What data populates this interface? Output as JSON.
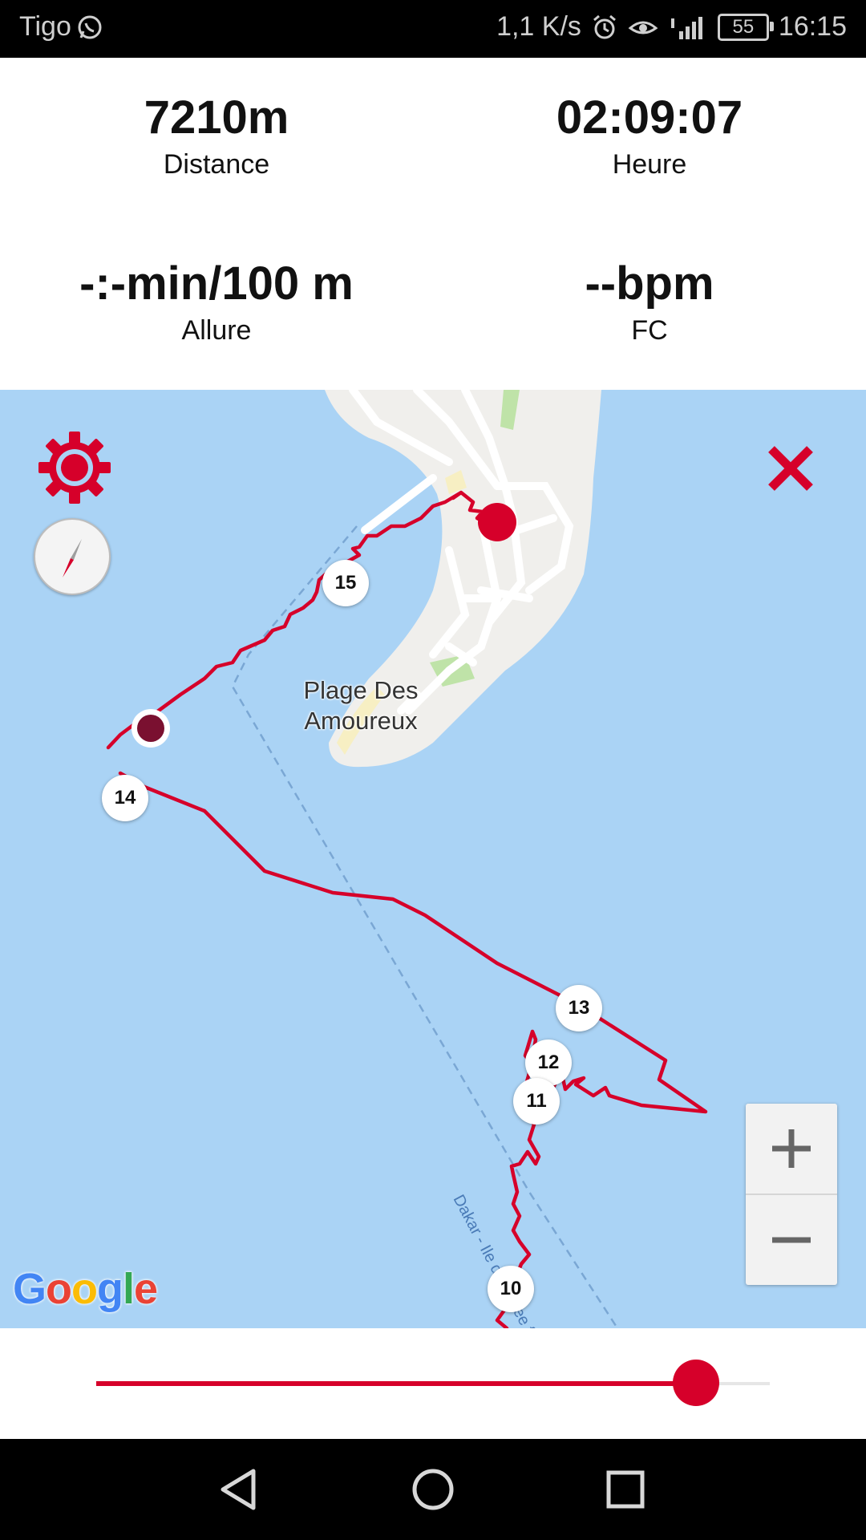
{
  "status_bar": {
    "carrier": "Tigo",
    "speed": "1,1 K/s",
    "battery": "55",
    "time": "16:15"
  },
  "stats": [
    {
      "value": "7210m",
      "label": "Distance"
    },
    {
      "value": "02:09:07",
      "label": "Heure"
    },
    {
      "value": "-:-min/100 m",
      "label": "Allure"
    },
    {
      "value": "--bpm",
      "label": "FC"
    }
  ],
  "map": {
    "place_label": "Plage Des Amoureux",
    "ferry_label": "Dakar - Ile de Goree ferry",
    "lap_markers": [
      "15",
      "14",
      "13",
      "12",
      "11",
      "10"
    ],
    "logo": "Google",
    "route_color": "#d6002a"
  },
  "slider": {
    "progress": 0.89
  },
  "icons": {
    "settings": "gear-icon",
    "compass": "compass-icon",
    "close": "close-icon",
    "zoom_in": "plus-icon",
    "zoom_out": "minus-icon"
  }
}
